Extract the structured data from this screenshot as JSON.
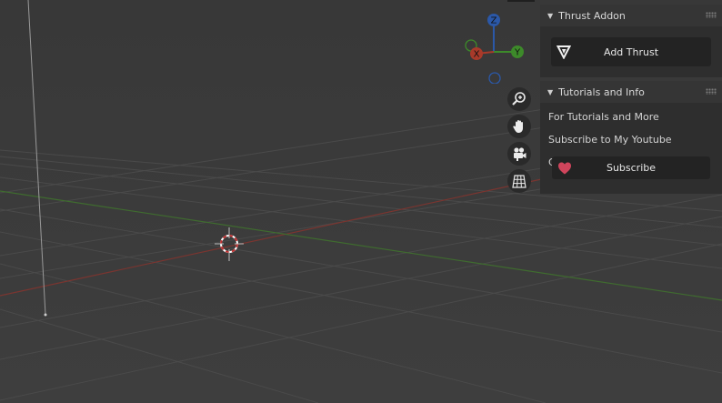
{
  "viewport": {
    "gizmo": {
      "x": "X",
      "y": "Y",
      "z": "Z"
    },
    "nav_icons": [
      "zoom-icon",
      "hand-pan-icon",
      "camera-icon",
      "grid-view-icon"
    ]
  },
  "thrust_panel": {
    "title": "Thrust Addon",
    "add_button": "Add Thrust"
  },
  "tutorials_panel": {
    "title": "Tutorials and Info",
    "line1": "For Tutorials and More",
    "line2": "Subscribe to My Youtube Channel",
    "subscribe_button": "Subscribe"
  },
  "colors": {
    "x_axis": "#a83a2a",
    "y_axis": "#3d8a2a",
    "z_axis": "#2b58a8",
    "heart": "#d0455c"
  }
}
